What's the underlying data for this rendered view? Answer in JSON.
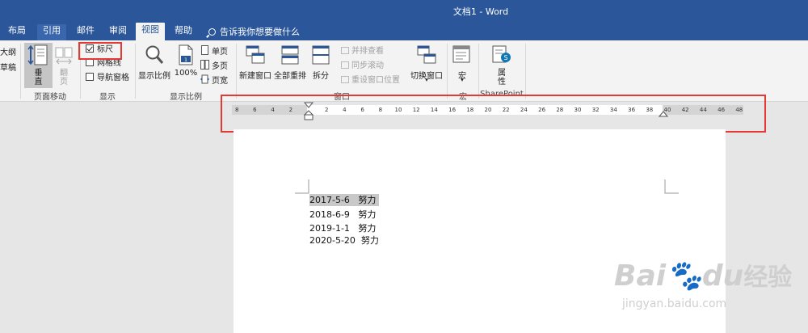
{
  "window": {
    "title": "文档1  -  Word"
  },
  "tabs": [
    {
      "label": "布局",
      "state": "normal"
    },
    {
      "label": "引用",
      "state": "hover"
    },
    {
      "label": "邮件",
      "state": "normal"
    },
    {
      "label": "审阅",
      "state": "normal"
    },
    {
      "label": "视图",
      "state": "active"
    },
    {
      "label": "帮助",
      "state": "normal"
    }
  ],
  "tell_me": "告诉我你想要做什么",
  "ribbon": {
    "views": {
      "outline": "大纲",
      "draft": "草稿"
    },
    "page_move": {
      "vertical_line1": "垂",
      "vertical_line2": "直",
      "side_line1": "翻",
      "side_line2": "页",
      "group": "页面移动"
    },
    "show": {
      "ruler": "标尺",
      "ruler_checked": true,
      "gridlines": "网格线",
      "gridlines_checked": false,
      "nav_pane": "导航窗格",
      "nav_pane_checked": false,
      "group": "显示"
    },
    "zoom": {
      "zoom": "显示比例",
      "hundred": "100%",
      "one_page": "单页",
      "multi_page": "多页",
      "page_width": "页宽",
      "group": "显示比例"
    },
    "window": {
      "new_window": "新建窗口",
      "arrange_all": "全部重排",
      "split": "拆分",
      "side_by_side": "并排查看",
      "sync_scroll": "同步滚动",
      "reset_pos": "重设窗口位置",
      "switch": "切换窗口",
      "group": "窗口"
    },
    "macros": {
      "label": "宏",
      "group": "宏"
    },
    "sharepoint": {
      "props_line1": "属",
      "props_line2": "性",
      "group": "SharePoint"
    }
  },
  "ruler": {
    "left_ticks": [
      "8",
      "6",
      "4",
      "2"
    ],
    "right_ticks": [
      "2",
      "4",
      "6",
      "8",
      "10",
      "12",
      "14",
      "16",
      "18",
      "20",
      "22",
      "24",
      "26",
      "28",
      "30",
      "32",
      "34",
      "36",
      "38",
      "40",
      "42",
      "44",
      "46",
      "48"
    ]
  },
  "document": {
    "lines": [
      {
        "text": "2017-5-6   努力",
        "selected": true
      },
      {
        "text": "2018-6-9   努力",
        "selected": false
      },
      {
        "text": "2019-1-1   努力",
        "selected": false
      },
      {
        "text": "2020-5-20  努力",
        "selected": false
      }
    ]
  },
  "watermark": {
    "brand": "Bai",
    "brand2": "du",
    "cn": "经验",
    "url": "jingyan.baidu.com"
  },
  "colors": {
    "titlebar": "#2b579a",
    "highlight": "#e53935"
  }
}
